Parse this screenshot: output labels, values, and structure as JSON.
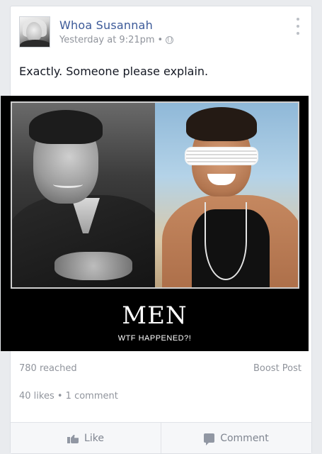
{
  "post": {
    "author": "Whoa Susannah",
    "timestamp": "Yesterday at 9:21pm",
    "separator": "•",
    "privacy_icon": "globe-icon",
    "text": "Exactly. Someone please explain.",
    "media": {
      "title": "MEN",
      "subtitle": "WTF HAPPENED?!"
    }
  },
  "stats": {
    "reached": "780 reached",
    "boost_label": "Boost Post",
    "engagement": "40 likes • 1 comment"
  },
  "actions": {
    "like_label": "Like",
    "comment_label": "Comment"
  },
  "colors": {
    "author_link": "#3b5998",
    "meta": "#90949c",
    "background": "#e9ebee"
  }
}
